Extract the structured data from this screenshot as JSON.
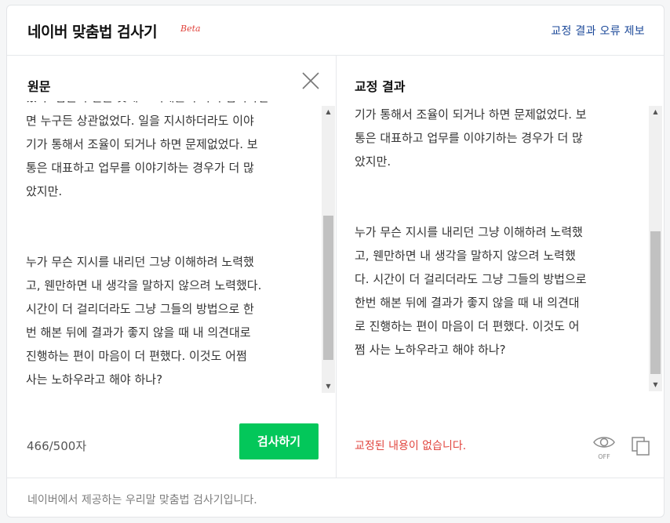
{
  "header": {
    "title": "네이버 맞춤법 검사기",
    "beta": "Beta",
    "report_link": "교정 결과 오류 제보"
  },
  "original": {
    "title": "원문",
    "text": "었다. 팀원이 일을 못해도 이해를 구하며 넘어가면\n면 누구든 상관없었다. 일을 지시하더라도 이야\n기가 통해서 조율이 되거나 하면 문제없었다. 보\n통은 대표하고 업무를 이야기하는 경우가 더 많\n았지만.\n\n\n누가 무슨 지시를 내리던 그냥 이해하려 노력했\n고, 웬만하면 내 생각을 말하지 않으려 노력했다.\n시간이 더 걸리더라도 그냥 그들의 방법으로 한\n번 해본 뒤에 결과가 좋지 않을 때 내 의견대로\n진행하는 편이 마음이 더 편했다. 이것도 어쩜\n사는 노하우라고 해야 하나?",
    "char_count": "466/500자",
    "check_button": "검사하기"
  },
  "result": {
    "title": "교정 결과",
    "text": "기가 통해서 조율이 되거나 하면 문제없었다. 보\n통은 대표하고 업무를 이야기하는 경우가 더 많\n았지만.\n\n\n누가 무슨 지시를 내리던 그냥 이해하려 노력했\n고, 웬만하면 내 생각을 말하지 않으려 노력했\n다. 시간이 더 걸리더라도 그냥 그들의 방법으로\n한번 해본 뒤에 결과가 좋지 않을 때 내 의견대\n로 진행하는 편이 마음이 더 편했다. 이것도 어\n쩜 사는 노하우라고 해야 하나?",
    "status": "교정된 내용이 없습니다.",
    "eye_toggle": "OFF"
  },
  "footer": {
    "text": "네이버에서 제공하는 우리말 맞춤법 검사기입니다."
  },
  "colors": {
    "accent_green": "#03c75a",
    "link_blue": "#1d4a9a",
    "error_red": "#e1463f"
  },
  "icons": [
    "close-icon",
    "eye-icon",
    "copy-icon",
    "scroll-up-arrow-icon",
    "scroll-down-arrow-icon"
  ]
}
